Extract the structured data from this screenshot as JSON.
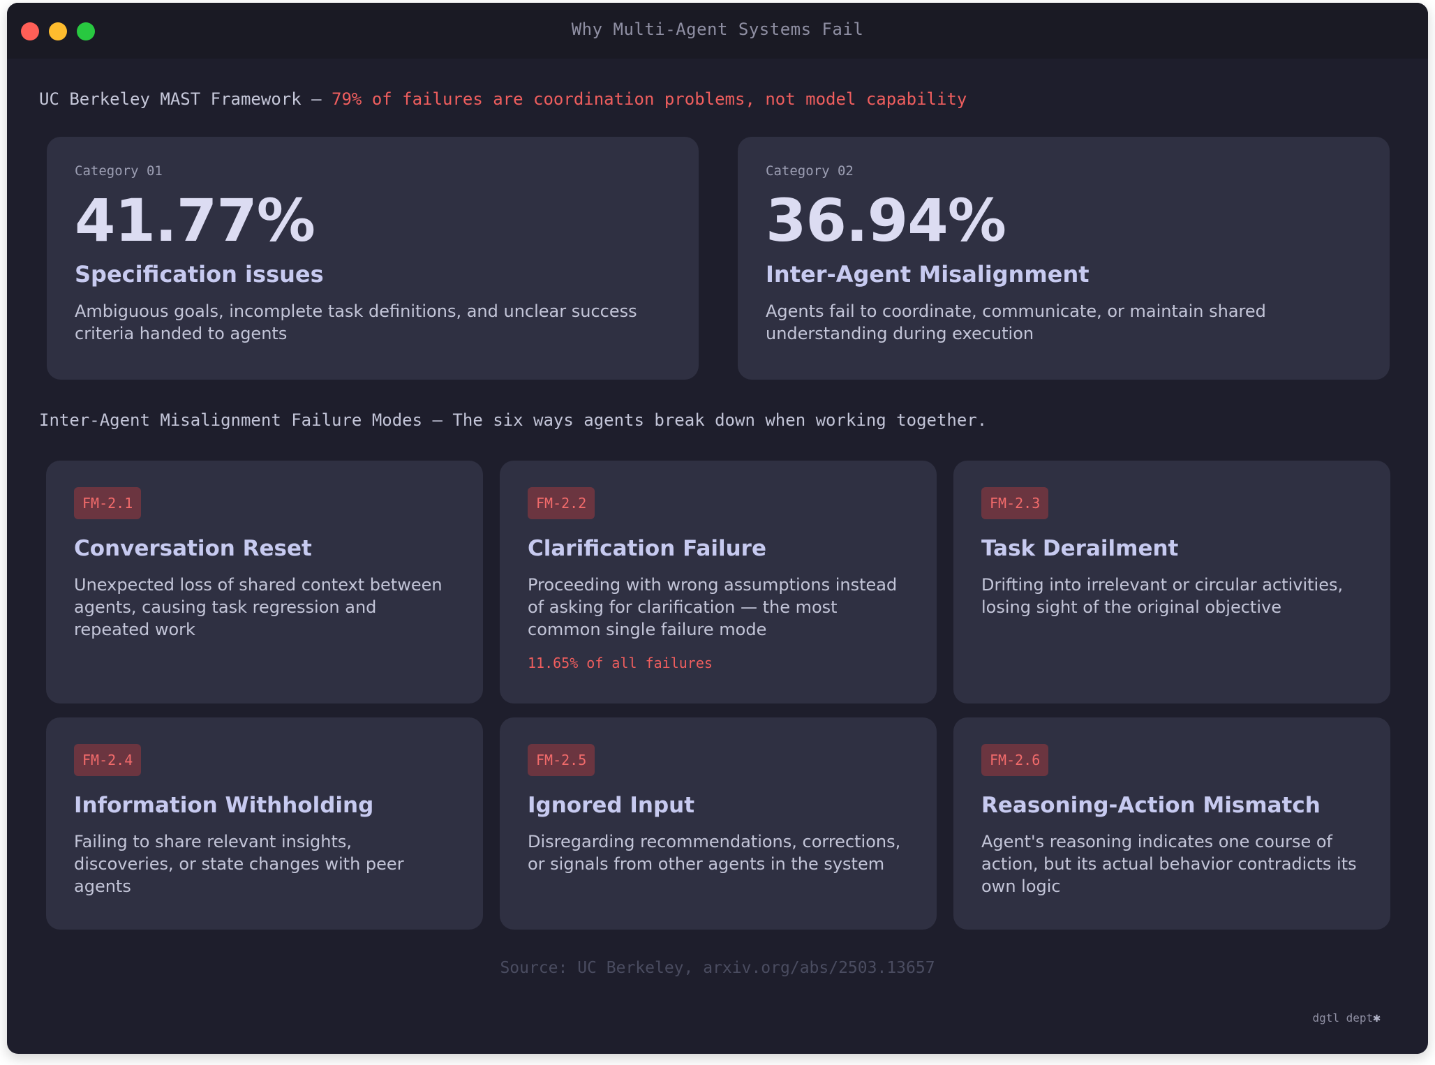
{
  "window": {
    "title": "Why Multi-Agent Systems Fail"
  },
  "headline": {
    "prefix": "UC Berkeley MAST Framework — ",
    "accent": "79% of failures are coordination problems, not model capability"
  },
  "categories": [
    {
      "label": "Category 01",
      "percent": "41.77%",
      "title": "Specification issues",
      "description": "Ambiguous goals, incomplete task definitions, and unclear success criteria handed to agents"
    },
    {
      "label": "Category 02",
      "percent": "36.94%",
      "title": "Inter-Agent Misalignment",
      "description": "Agents fail to coordinate, communicate, or maintain shared understanding during execution"
    }
  ],
  "section": {
    "title": "Inter-Agent Misalignment Failure Modes — The six ways agents break down when working together."
  },
  "failure_modes": [
    {
      "code": "FM-2.1",
      "title": "Conversation Reset",
      "description": "Unexpected loss of shared context between agents, causing task regression and repeated work"
    },
    {
      "code": "FM-2.2",
      "title": "Clarification Failure",
      "description": "Proceeding with wrong assumptions instead of asking for clarification — the most common single failure mode",
      "stat": "11.65% of all failures"
    },
    {
      "code": "FM-2.3",
      "title": "Task Derailment",
      "description": "Drifting into irrelevant or circular activities, losing sight of the original objective"
    },
    {
      "code": "FM-2.4",
      "title": "Information Withholding",
      "description": "Failing to share relevant insights, discoveries, or state changes with peer agents"
    },
    {
      "code": "FM-2.5",
      "title": "Ignored Input",
      "description": "Disregarding recommendations, corrections, or signals from other agents in the system"
    },
    {
      "code": "FM-2.6",
      "title": "Reasoning-Action Mismatch",
      "description": "Agent's reasoning indicates one course of action, but its actual behavior contradicts its own logic"
    }
  ],
  "footer": {
    "source": "Source: UC Berkeley, arxiv.org/abs/2503.13657",
    "brand": "dgtl dept",
    "brand_mark": "✱"
  },
  "colors": {
    "window_bg": "#1e1e2c",
    "card_bg": "#2f3042",
    "accent_red": "#ef5e5e",
    "badge_bg": "#6b3540"
  }
}
